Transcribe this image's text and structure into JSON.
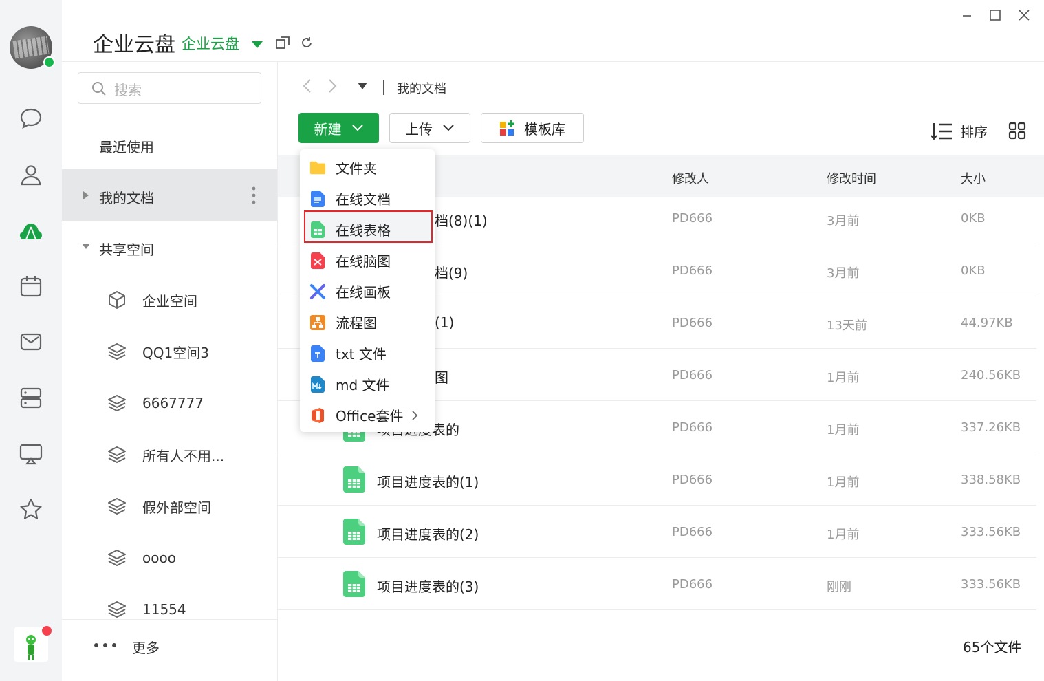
{
  "app": {
    "title": "企业云盘",
    "space_selector": "企业云盘"
  },
  "sidebar": {
    "search_placeholder": "搜索",
    "recent": "最近使用",
    "my_docs": "我的文档",
    "shared_space": "共享空间",
    "spaces": [
      "企业空间",
      "QQ1空间3",
      "6667777",
      "所有人不用...",
      "假外部空间",
      "oooo",
      "11554"
    ],
    "more": "更多"
  },
  "breadcrumb": {
    "current": "我的文档"
  },
  "toolbar": {
    "new_label": "新建",
    "upload_label": "上传",
    "template_label": "模板库",
    "sort_label": "排序"
  },
  "table": {
    "headers": {
      "modifier": "修改人",
      "modified_time": "修改时间",
      "size": "大小"
    },
    "rows": [
      {
        "name": "档(8)(1)",
        "modifier": "PD666",
        "time": "3月前",
        "size": "0KB"
      },
      {
        "name": "档(9)",
        "modifier": "PD666",
        "time": "3月前",
        "size": "0KB"
      },
      {
        "name": "(1)",
        "modifier": "PD666",
        "time": "13天前",
        "size": "44.97KB"
      },
      {
        "name": "图",
        "modifier": "PD666",
        "time": "1月前",
        "size": "240.56KB"
      },
      {
        "name": "项目进度表的",
        "modifier": "PD666",
        "time": "1月前",
        "size": "337.26KB"
      },
      {
        "name": "项目进度表的(1)",
        "modifier": "PD666",
        "time": "1月前",
        "size": "338.58KB"
      },
      {
        "name": "项目进度表的(2)",
        "modifier": "PD666",
        "time": "1月前",
        "size": "333.56KB"
      },
      {
        "name": "项目进度表的(3)",
        "modifier": "PD666",
        "time": "刚刚",
        "size": "333.56KB"
      }
    ],
    "file_count": "65个文件"
  },
  "new_menu": {
    "items": [
      "文件夹",
      "在线文档",
      "在线表格",
      "在线脑图",
      "在线画板",
      "流程图",
      "txt 文件",
      "md 文件",
      "Office套件"
    ],
    "highlighted": "在线表格"
  },
  "colors": {
    "brand_green": "#1aa346",
    "highlight_red": "#e5262b"
  }
}
